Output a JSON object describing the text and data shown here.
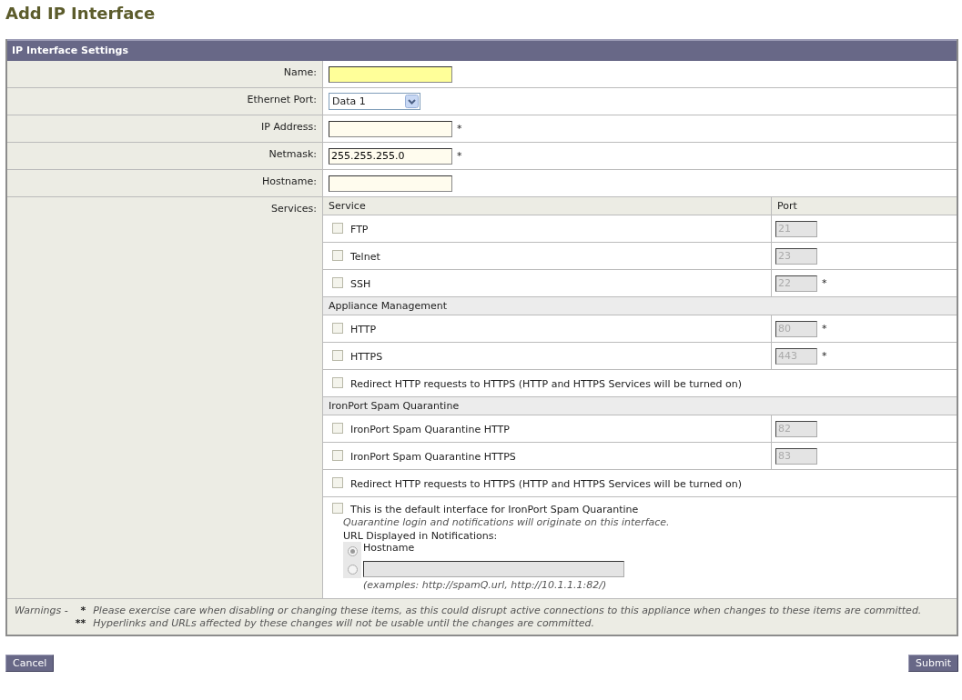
{
  "page_title": "Add IP Interface",
  "panel": {
    "title": "IP Interface Settings",
    "fields": [
      {
        "label": "Name:",
        "kind": "text",
        "highlighted": true
      },
      {
        "label": "Ethernet Port:",
        "kind": "select",
        "value": "Data 1"
      },
      {
        "label": "IP Address:",
        "kind": "text",
        "highlighted": false,
        "mark": "*"
      },
      {
        "label": "Netmask:",
        "kind": "text",
        "highlighted": false,
        "value": "255.255.255.0",
        "mark": "*"
      },
      {
        "label": "Hostname:",
        "kind": "text",
        "highlighted": false
      }
    ],
    "services": {
      "label": "Services:",
      "columns": [
        "Service",
        "Port"
      ],
      "rows": [
        {
          "kind": "service",
          "label": "FTP",
          "checked": false,
          "port": "21"
        },
        {
          "kind": "service",
          "label": "Telnet",
          "checked": false,
          "port": "23"
        },
        {
          "kind": "service",
          "label": "SSH",
          "checked": false,
          "port": "22",
          "mark": "*"
        },
        {
          "kind": "section",
          "label": "Appliance Management"
        },
        {
          "kind": "service",
          "label": "HTTP",
          "checked": false,
          "port": "80",
          "mark": "*"
        },
        {
          "kind": "service",
          "label": "HTTPS",
          "checked": false,
          "port": "443",
          "mark": "*"
        },
        {
          "kind": "option",
          "label": "Redirect HTTP requests to HTTPS (HTTP and HTTPS Services will be turned on)",
          "checked": false
        },
        {
          "kind": "section",
          "label": "IronPort Spam Quarantine"
        },
        {
          "kind": "service",
          "label": "IronPort Spam Quarantine HTTP",
          "checked": false,
          "port": "82"
        },
        {
          "kind": "service",
          "label": "IronPort Spam Quarantine HTTPS",
          "checked": false,
          "port": "83"
        },
        {
          "kind": "option",
          "label": "Redirect HTTP requests to HTTPS (HTTP and HTTPS Services will be turned on)",
          "checked": false
        },
        {
          "kind": "default",
          "label": "This is the default interface for IronPort Spam Quarantine",
          "checked": false,
          "note": "Quarantine login and notifications will originate on this interface.",
          "url_label": "URL Displayed in Notifications:",
          "choices": [
            {
              "kind": "label",
              "label": "Hostname",
              "selected": true
            },
            {
              "kind": "field",
              "selected": false
            }
          ],
          "example": "(examples: http://spamQ.url, http://10.1.1.1:82/)"
        }
      ]
    },
    "warnings": {
      "label": "Warnings -",
      "items": [
        {
          "mark": "*",
          "text": "Please exercise care when disabling or changing these items, as this could disrupt active connections to this appliance when changes to these items are committed."
        },
        {
          "mark": "**",
          "text": "Hyperlinks and URLs affected by these changes will not be usable until the changes are committed."
        }
      ]
    }
  },
  "buttons": [
    {
      "label": "Cancel"
    },
    {
      "label": "Submit"
    }
  ]
}
